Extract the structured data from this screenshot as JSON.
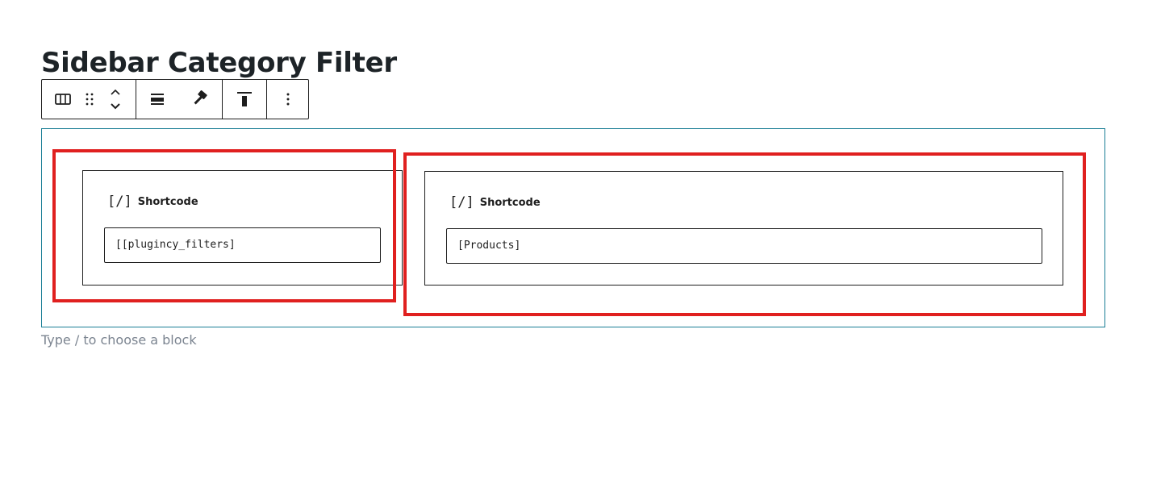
{
  "page": {
    "title": "Sidebar Category Filter"
  },
  "toolbar": {
    "icons": [
      "columns-icon",
      "drag-handle-icon",
      "move-up-icon",
      "move-down-icon",
      "vertical-align-icon",
      "hammer-icon",
      "align-top-icon",
      "more-options-icon"
    ]
  },
  "columns": [
    {
      "block_icon": "[/]",
      "block_label": "Shortcode",
      "value": "[[plugincy_filters]"
    },
    {
      "block_icon": "[/]",
      "block_label": "Shortcode",
      "value": "[Products]"
    }
  ],
  "appender": {
    "hint": "Type / to choose a block"
  },
  "colors": {
    "highlight": "#e0201f",
    "selected_border": "#1a7e95",
    "text": "#1e1e1e",
    "hint": "#7b8490"
  }
}
